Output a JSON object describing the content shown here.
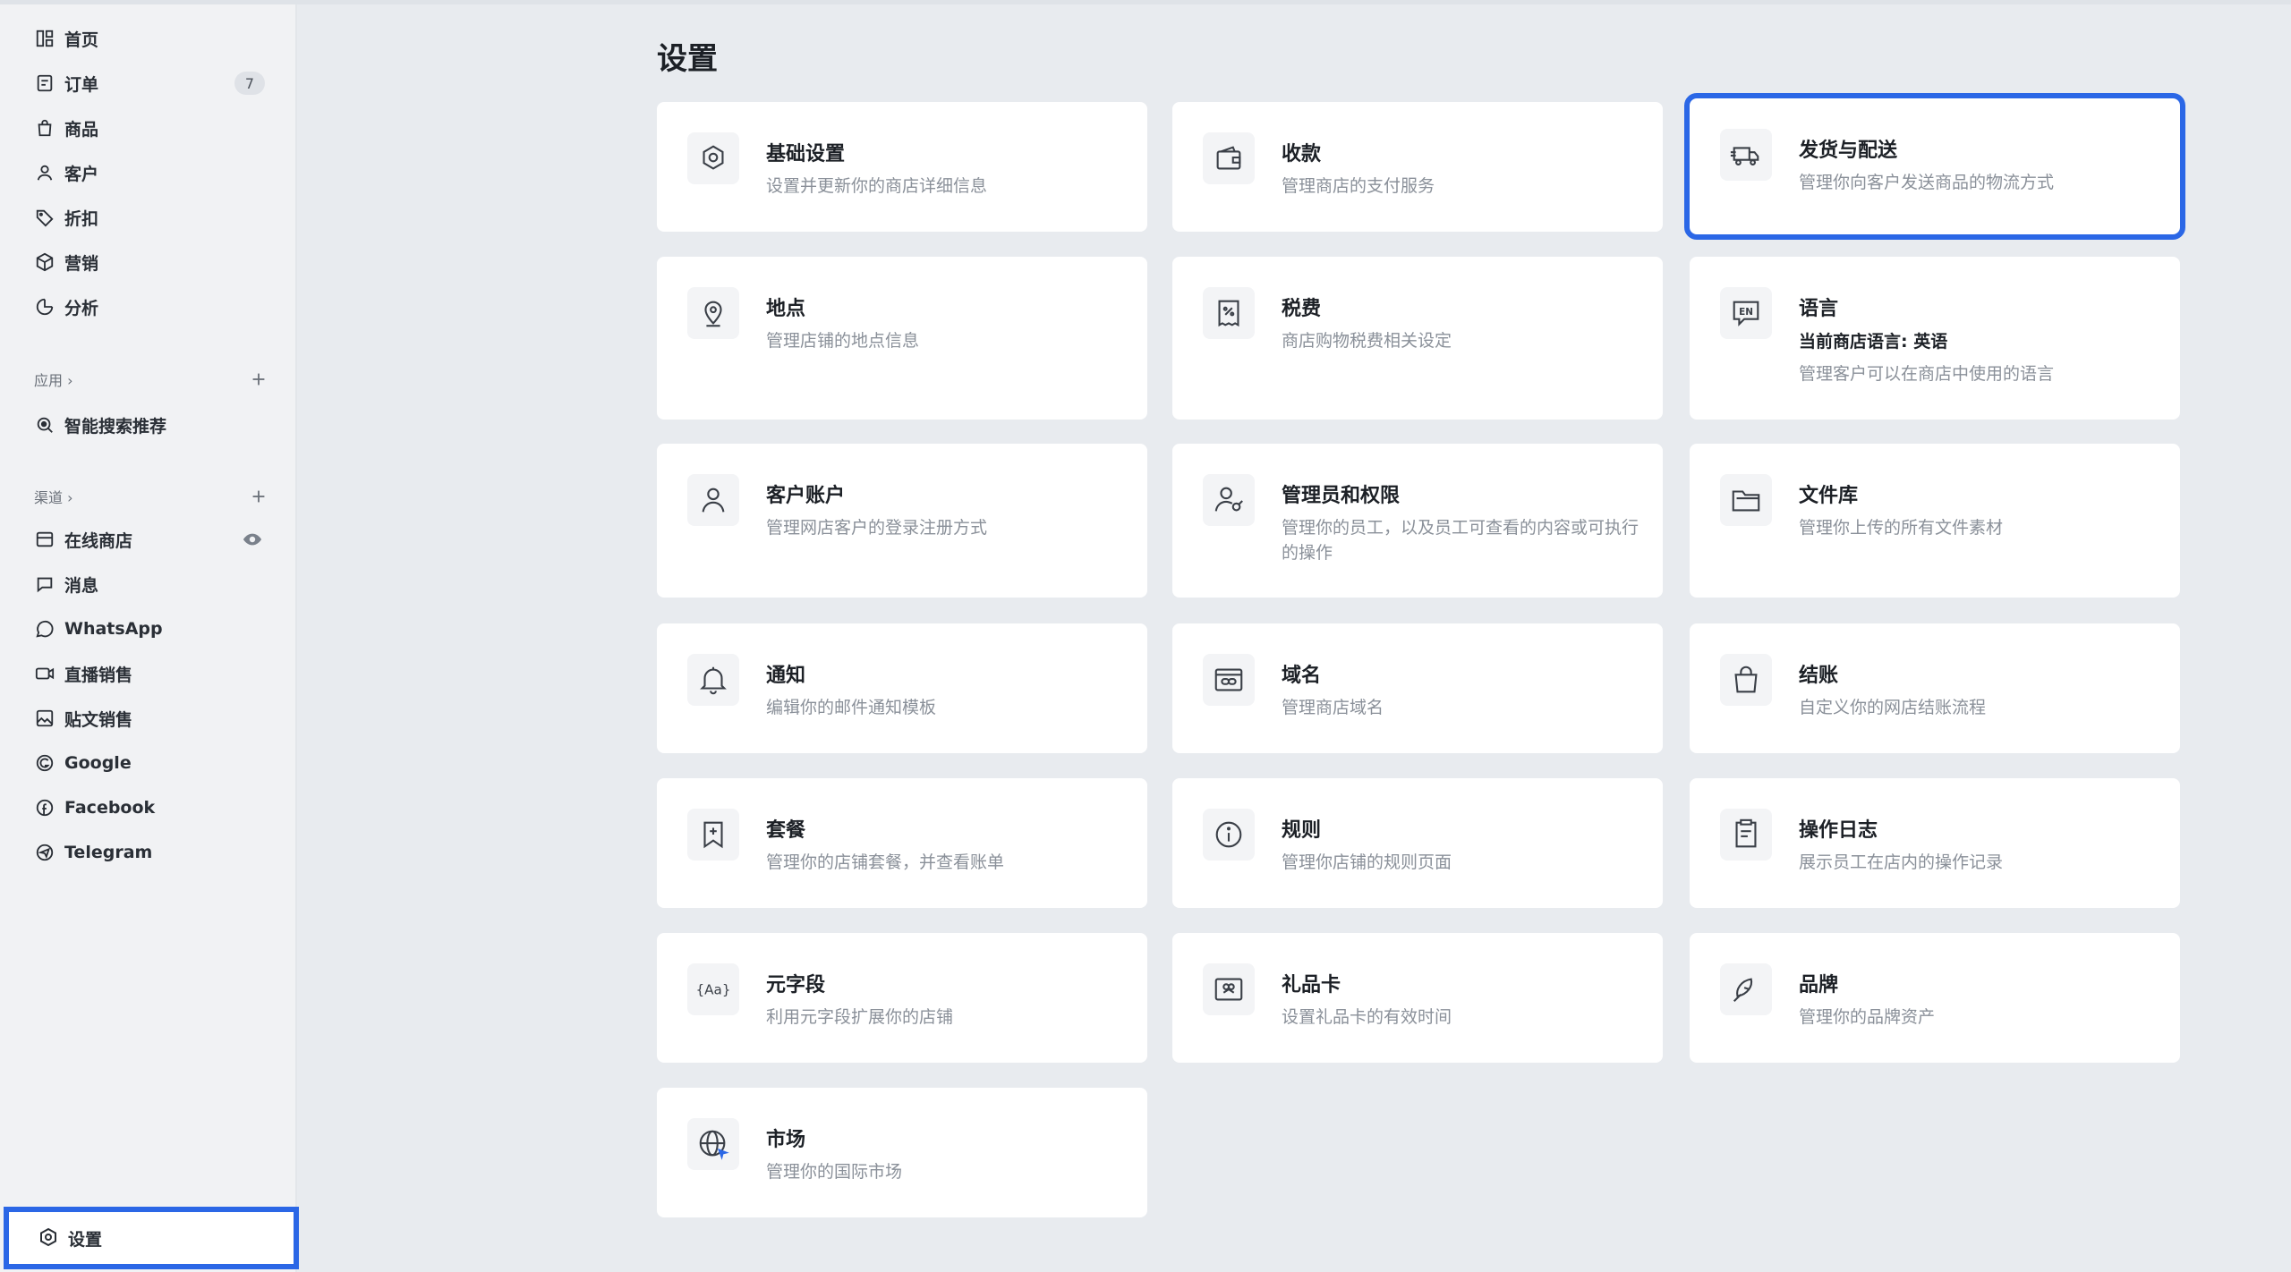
{
  "sidebar": {
    "main_items": [
      {
        "label": "首页",
        "icon": "dashboard-icon"
      },
      {
        "label": "订单",
        "icon": "order-icon",
        "badge": "7"
      },
      {
        "label": "商品",
        "icon": "bag-icon"
      },
      {
        "label": "客户",
        "icon": "user-icon"
      },
      {
        "label": "折扣",
        "icon": "tag-icon"
      },
      {
        "label": "营销",
        "icon": "box-icon"
      },
      {
        "label": "分析",
        "icon": "pie-chart-icon"
      }
    ],
    "apps_section": {
      "title": "应用 ›",
      "items": [
        {
          "label": "智能搜索推荐",
          "icon": "search-icon"
        }
      ]
    },
    "channels_section": {
      "title": "渠道 ›",
      "items": [
        {
          "label": "在线商店",
          "icon": "store-icon"
        },
        {
          "label": "消息",
          "icon": "chat-icon"
        },
        {
          "label": "WhatsApp",
          "icon": "whatsapp-icon"
        },
        {
          "label": "直播销售",
          "icon": "video-icon"
        },
        {
          "label": "贴文销售",
          "icon": "image-icon"
        },
        {
          "label": "Google",
          "icon": "google-icon"
        },
        {
          "label": "Facebook",
          "icon": "facebook-icon"
        },
        {
          "label": "Telegram",
          "icon": "telegram-icon"
        }
      ]
    },
    "settings_label": "设置"
  },
  "main": {
    "title": "设置",
    "cards": [
      {
        "title": "基础设置",
        "desc": "设置并更新你的商店详细信息",
        "icon": "gear-icon"
      },
      {
        "title": "收款",
        "desc": "管理商店的支付服务",
        "icon": "wallet-icon"
      },
      {
        "title": "发货与配送",
        "desc": "管理你向客户发送商品的物流方式",
        "icon": "truck-icon"
      },
      {
        "title": "地点",
        "desc": "管理店铺的地点信息",
        "icon": "location-icon"
      },
      {
        "title": "税费",
        "desc": "商店购物税费相关设定",
        "icon": "receipt-icon"
      },
      {
        "title": "语言",
        "extra": "当前商店语言: 英语",
        "desc": "管理客户可以在商店中使用的语言",
        "icon": "language-icon"
      },
      {
        "title": "客户账户",
        "desc": "管理网店客户的登录注册方式",
        "icon": "user-icon"
      },
      {
        "title": "管理员和权限",
        "desc": "管理你的员工，以及员工可查看的内容或可执行的操作",
        "icon": "admin-icon"
      },
      {
        "title": "文件库",
        "desc": "管理你上传的所有文件素材",
        "icon": "folder-icon"
      },
      {
        "title": "通知",
        "desc": "编辑你的邮件通知模板",
        "icon": "bell-icon"
      },
      {
        "title": "域名",
        "desc": "管理商店域名",
        "icon": "link-icon"
      },
      {
        "title": "结账",
        "desc": "自定义你的网店结账流程",
        "icon": "shopping-bag-icon"
      },
      {
        "title": "套餐",
        "desc": "管理你的店铺套餐，并查看账单",
        "icon": "bookmark-plus-icon"
      },
      {
        "title": "规则",
        "desc": "管理你店铺的规则页面",
        "icon": "info-icon"
      },
      {
        "title": "操作日志",
        "desc": "展示员工在店内的操作记录",
        "icon": "log-icon"
      },
      {
        "title": "元字段",
        "desc": "利用元字段扩展你的店铺",
        "icon": "metafield-icon"
      },
      {
        "title": "礼品卡",
        "desc": "设置礼品卡的有效时间",
        "icon": "gift-card-icon"
      },
      {
        "title": "品牌",
        "desc": "管理你的品牌资产",
        "icon": "brand-icon"
      },
      {
        "title": "市场",
        "desc": "管理你的国际市场",
        "icon": "globe-icon"
      }
    ]
  },
  "colors": {
    "accent": "#2b67e6",
    "background": "#e8ebef",
    "card": "#ffffff"
  }
}
